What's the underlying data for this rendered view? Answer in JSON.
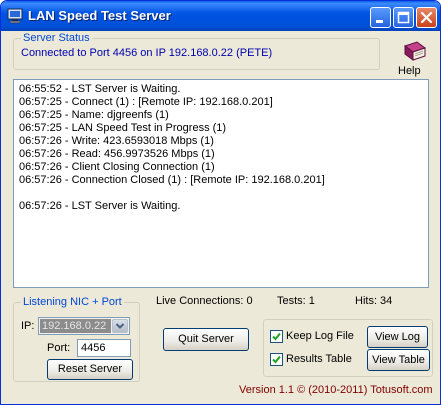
{
  "window": {
    "title": "LAN Speed Test Server"
  },
  "server_status": {
    "group_title": "Server Status",
    "value": "Connected to Port 4456 on IP 192.168.0.22 (PETE)"
  },
  "help": {
    "label": "Help",
    "icon": "book-icon"
  },
  "log": {
    "lines": [
      "06:55:52 - LST Server is Waiting.",
      "06:57:25 - Connect (1) :  [Remote IP: 192.168.0.201]",
      "06:57:25 - Name: djgreenfs (1)",
      "06:57:25 - LAN Speed Test in Progress (1)",
      "06:57:26 - Write: 423.6593018 Mbps (1)",
      "06:57:26 - Read: 456.9973526 Mbps (1)",
      "06:57:26 - Client Closing Connection (1)",
      "06:57:26 - Connection Closed (1) :  [Remote IP: 192.168.0.201]",
      "",
      "06:57:26 - LST Server is Waiting."
    ]
  },
  "stats": {
    "live_connections": "Live Connections:  0",
    "tests": "Tests:  1",
    "hits": "Hits: 34"
  },
  "nic": {
    "group_title": "Listening NIC + Port",
    "ip_label": "IP:",
    "ip_value": "192.168.0.22",
    "port_label": "Port:",
    "port_value": "4456",
    "reset_label": "Reset Server"
  },
  "controls": {
    "quit_label": "Quit Server",
    "keep_log_label": "Keep Log File",
    "keep_log_checked": true,
    "results_table_label": "Results Table",
    "results_table_checked": true,
    "view_log_label": "View Log",
    "view_table_label": "View Table"
  },
  "footer": {
    "text": "Version 1.1   © (2010-2011) Totusoft.com"
  },
  "colors": {
    "titlebar": "#0054e3",
    "group_title": "#0046d5",
    "status_text": "#0000b0",
    "footer_text": "#800000"
  }
}
